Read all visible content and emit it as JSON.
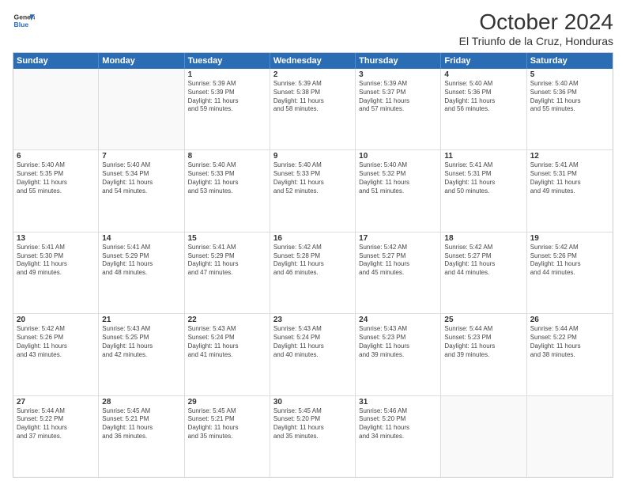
{
  "logo": {
    "general": "General",
    "blue": "Blue"
  },
  "header": {
    "month": "October 2024",
    "location": "El Triunfo de la Cruz, Honduras"
  },
  "days": [
    "Sunday",
    "Monday",
    "Tuesday",
    "Wednesday",
    "Thursday",
    "Friday",
    "Saturday"
  ],
  "rows": [
    [
      {
        "num": "",
        "lines": []
      },
      {
        "num": "",
        "lines": []
      },
      {
        "num": "1",
        "lines": [
          "Sunrise: 5:39 AM",
          "Sunset: 5:39 PM",
          "Daylight: 11 hours",
          "and 59 minutes."
        ]
      },
      {
        "num": "2",
        "lines": [
          "Sunrise: 5:39 AM",
          "Sunset: 5:38 PM",
          "Daylight: 11 hours",
          "and 58 minutes."
        ]
      },
      {
        "num": "3",
        "lines": [
          "Sunrise: 5:39 AM",
          "Sunset: 5:37 PM",
          "Daylight: 11 hours",
          "and 57 minutes."
        ]
      },
      {
        "num": "4",
        "lines": [
          "Sunrise: 5:40 AM",
          "Sunset: 5:36 PM",
          "Daylight: 11 hours",
          "and 56 minutes."
        ]
      },
      {
        "num": "5",
        "lines": [
          "Sunrise: 5:40 AM",
          "Sunset: 5:36 PM",
          "Daylight: 11 hours",
          "and 55 minutes."
        ]
      }
    ],
    [
      {
        "num": "6",
        "lines": [
          "Sunrise: 5:40 AM",
          "Sunset: 5:35 PM",
          "Daylight: 11 hours",
          "and 55 minutes."
        ]
      },
      {
        "num": "7",
        "lines": [
          "Sunrise: 5:40 AM",
          "Sunset: 5:34 PM",
          "Daylight: 11 hours",
          "and 54 minutes."
        ]
      },
      {
        "num": "8",
        "lines": [
          "Sunrise: 5:40 AM",
          "Sunset: 5:33 PM",
          "Daylight: 11 hours",
          "and 53 minutes."
        ]
      },
      {
        "num": "9",
        "lines": [
          "Sunrise: 5:40 AM",
          "Sunset: 5:33 PM",
          "Daylight: 11 hours",
          "and 52 minutes."
        ]
      },
      {
        "num": "10",
        "lines": [
          "Sunrise: 5:40 AM",
          "Sunset: 5:32 PM",
          "Daylight: 11 hours",
          "and 51 minutes."
        ]
      },
      {
        "num": "11",
        "lines": [
          "Sunrise: 5:41 AM",
          "Sunset: 5:31 PM",
          "Daylight: 11 hours",
          "and 50 minutes."
        ]
      },
      {
        "num": "12",
        "lines": [
          "Sunrise: 5:41 AM",
          "Sunset: 5:31 PM",
          "Daylight: 11 hours",
          "and 49 minutes."
        ]
      }
    ],
    [
      {
        "num": "13",
        "lines": [
          "Sunrise: 5:41 AM",
          "Sunset: 5:30 PM",
          "Daylight: 11 hours",
          "and 49 minutes."
        ]
      },
      {
        "num": "14",
        "lines": [
          "Sunrise: 5:41 AM",
          "Sunset: 5:29 PM",
          "Daylight: 11 hours",
          "and 48 minutes."
        ]
      },
      {
        "num": "15",
        "lines": [
          "Sunrise: 5:41 AM",
          "Sunset: 5:29 PM",
          "Daylight: 11 hours",
          "and 47 minutes."
        ]
      },
      {
        "num": "16",
        "lines": [
          "Sunrise: 5:42 AM",
          "Sunset: 5:28 PM",
          "Daylight: 11 hours",
          "and 46 minutes."
        ]
      },
      {
        "num": "17",
        "lines": [
          "Sunrise: 5:42 AM",
          "Sunset: 5:27 PM",
          "Daylight: 11 hours",
          "and 45 minutes."
        ]
      },
      {
        "num": "18",
        "lines": [
          "Sunrise: 5:42 AM",
          "Sunset: 5:27 PM",
          "Daylight: 11 hours",
          "and 44 minutes."
        ]
      },
      {
        "num": "19",
        "lines": [
          "Sunrise: 5:42 AM",
          "Sunset: 5:26 PM",
          "Daylight: 11 hours",
          "and 44 minutes."
        ]
      }
    ],
    [
      {
        "num": "20",
        "lines": [
          "Sunrise: 5:42 AM",
          "Sunset: 5:26 PM",
          "Daylight: 11 hours",
          "and 43 minutes."
        ]
      },
      {
        "num": "21",
        "lines": [
          "Sunrise: 5:43 AM",
          "Sunset: 5:25 PM",
          "Daylight: 11 hours",
          "and 42 minutes."
        ]
      },
      {
        "num": "22",
        "lines": [
          "Sunrise: 5:43 AM",
          "Sunset: 5:24 PM",
          "Daylight: 11 hours",
          "and 41 minutes."
        ]
      },
      {
        "num": "23",
        "lines": [
          "Sunrise: 5:43 AM",
          "Sunset: 5:24 PM",
          "Daylight: 11 hours",
          "and 40 minutes."
        ]
      },
      {
        "num": "24",
        "lines": [
          "Sunrise: 5:43 AM",
          "Sunset: 5:23 PM",
          "Daylight: 11 hours",
          "and 39 minutes."
        ]
      },
      {
        "num": "25",
        "lines": [
          "Sunrise: 5:44 AM",
          "Sunset: 5:23 PM",
          "Daylight: 11 hours",
          "and 39 minutes."
        ]
      },
      {
        "num": "26",
        "lines": [
          "Sunrise: 5:44 AM",
          "Sunset: 5:22 PM",
          "Daylight: 11 hours",
          "and 38 minutes."
        ]
      }
    ],
    [
      {
        "num": "27",
        "lines": [
          "Sunrise: 5:44 AM",
          "Sunset: 5:22 PM",
          "Daylight: 11 hours",
          "and 37 minutes."
        ]
      },
      {
        "num": "28",
        "lines": [
          "Sunrise: 5:45 AM",
          "Sunset: 5:21 PM",
          "Daylight: 11 hours",
          "and 36 minutes."
        ]
      },
      {
        "num": "29",
        "lines": [
          "Sunrise: 5:45 AM",
          "Sunset: 5:21 PM",
          "Daylight: 11 hours",
          "and 35 minutes."
        ]
      },
      {
        "num": "30",
        "lines": [
          "Sunrise: 5:45 AM",
          "Sunset: 5:20 PM",
          "Daylight: 11 hours",
          "and 35 minutes."
        ]
      },
      {
        "num": "31",
        "lines": [
          "Sunrise: 5:46 AM",
          "Sunset: 5:20 PM",
          "Daylight: 11 hours",
          "and 34 minutes."
        ]
      },
      {
        "num": "",
        "lines": []
      },
      {
        "num": "",
        "lines": []
      }
    ]
  ]
}
